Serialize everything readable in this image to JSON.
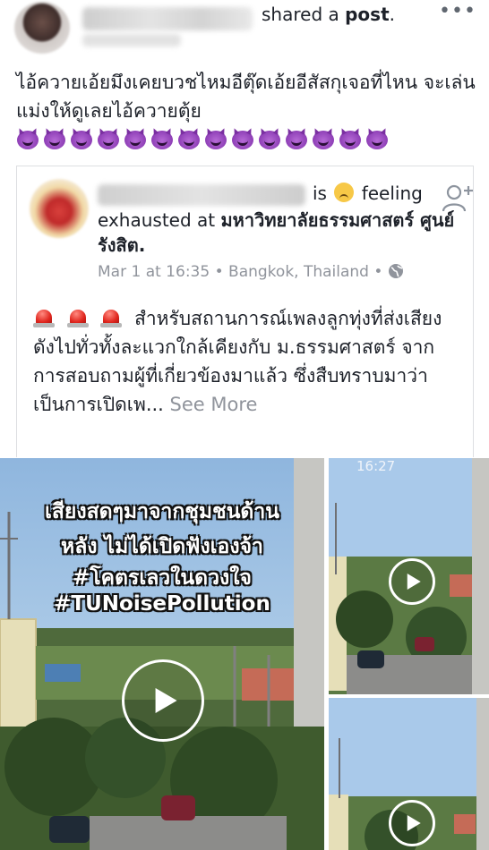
{
  "post": {
    "shared_prefix": "shared a",
    "shared_object": "post",
    "shared_suffix": ".",
    "more_label": "•••",
    "text_line": "ไอ้ควายเอ้ยมึงเคยบวชไหมอีตุ๊ดเอ้ยอีสัสกุเจอที่ไหน จะเล่นแม่งให้ดูเลยไอ้ควายตุ้ย",
    "emoji_name": "devil-emoji",
    "emoji_count": 14
  },
  "shared": {
    "is_text": "is",
    "feeling_text": "feeling",
    "feeling_detail": "exhausted at",
    "place": "มหาวิทยาลัยธรรมศาสตร์ ศูนย์รังสิต.",
    "date": "Mar 1 at 16:35",
    "separator": "•",
    "location": "Bangkok, Thailand",
    "body": "สำหรับสถานการณ์เพลงลูกทุ่งที่ส่งเสียงดังไปทั่วทั้งละแวกใกล้เคียงกับ ม.ธรรมศาสตร์ จากการสอบถามผู้ที่เกี่ยวข้องมาแล้ว ซึ่งสืบทราบมาว่าเป็นการเปิดเพ...",
    "see_more": "See More"
  },
  "media": {
    "overlay_line1": "เสียงสดๆมาจากชุมชนด้าน",
    "overlay_line2": "หลัง ไม่ได้เปิดฟังเองจ้า",
    "overlay_line3": "#โคตรเลวในดวงใจ",
    "overlay_line4": "#TUNoisePollution",
    "timestamp": "16:27"
  },
  "colors": {
    "text": "#1d2129",
    "meta": "#90949c",
    "border": "#dddfe2"
  }
}
